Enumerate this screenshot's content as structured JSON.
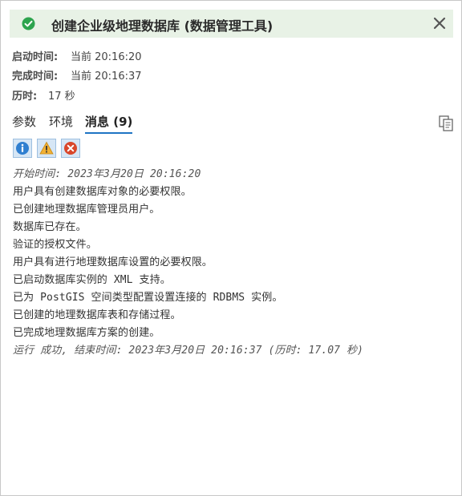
{
  "header": {
    "title": "创建企业级地理数据库 (数据管理工具)",
    "status_color": "#2da44e",
    "background": "#e8f2e6",
    "icons": {
      "status": "check-circle-icon",
      "close": "close-icon"
    }
  },
  "info": {
    "start_label": "启动时间:",
    "start_value": "当前 20:16:20",
    "end_label": "完成时间:",
    "end_value": "当前 20:16:37",
    "elapsed_label": "历时:",
    "elapsed_value": "17 秒"
  },
  "tabs": [
    {
      "label": "参数"
    },
    {
      "label": "环境"
    },
    {
      "label": "消息 (9)"
    }
  ],
  "active_tab_color": "#1e74c4",
  "filters": {
    "info_icon": "info-icon",
    "warning_icon": "warning-icon",
    "error_icon": "error-icon"
  },
  "messages": [
    "开始时间: 2023年3月20日 20:16:20",
    "用户具有创建数据库对象的必要权限。",
    "已创建地理数据库管理员用户。",
    "数据库已存在。",
    "验证的授权文件。",
    "用户具有进行地理数据库设置的必要权限。",
    "已启动数据库实例的 XML 支持。",
    "已为 PostGIS 空间类型配置设置连接的 RDBMS 实例。",
    "已创建的地理数据库表和存储过程。",
    "已完成地理数据库方案的创建。",
    "运行 成功, 结束时间:  2023年3月20日 20:16:37 (历时: 17.07 秒)"
  ]
}
